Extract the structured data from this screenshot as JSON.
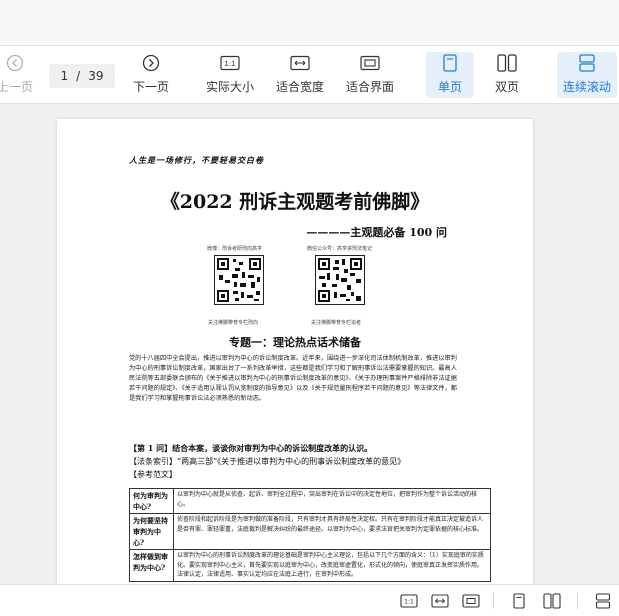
{
  "toolbar": {
    "prev_label": "上一页",
    "page_current": "1",
    "page_sep": "/",
    "page_total": "39",
    "next_label": "下一页",
    "actual_size_label": "实际大小",
    "fit_width_label": "适合宽度",
    "fit_page_label": "适合界面",
    "single_page_label": "单页",
    "double_page_label": "双页",
    "continuous_label": "连续滚动",
    "accent_color": "#1e7be0"
  },
  "document": {
    "motto": "人生是一场修行，不要轻易交白卷",
    "title": "《2022 刑诉主观题考前佛脚》",
    "subtitle": "————主观题必备 100 问",
    "qr_left_caption": "微博：刑诉考研刑向高亨",
    "qr_right_caption": "微信公众号：高亨讲刑法笔记",
    "qr_left_footer": "关注佛脚带育专栏刑向",
    "qr_right_footer": "关注佛脚带育专栏追者",
    "topic_heading": "专题一：理论热点话术储备",
    "intro": "党的十八届四中全会提出，推进以审判为中心的诉讼制度改革。近年来，围绕进一步深化司法体制机制改革，推进以审判为中心的刑事诉讼制度改革，国家出台了一系列改革举措，这些都是我们学习和了解刑事诉讼法需要掌握的知识。最高人民法院等五部委联合颁布的《关于推进以审判为中心的刑事诉讼制度改革的意见》、《关于办理刑事案件严格排除非法证据若干问题的规定》、《关于适用认罪认罚从宽制度的指导意见》以及《关于规范量刑程序若干问题的意见》等法律文件，都是我们学习和掌握刑事诉讼法必须熟悉的新动态。",
    "q1": "【第 1 问】结合本案，谈谈你对审判为中心的诉讼制度改革的认识。",
    "index": "【法条索引】“两高三部”《关于推进以审判为中心的刑事诉讼制度改革的意见》",
    "ref_label": "【参考范文】",
    "table": [
      {
        "q": "何为审判为中心?",
        "a": "以审判为中心就是从侦查、起诉、审判全过程中，突出审判在诉讼中的决定性地位，把审判作为整个诉讼活动的核心。"
      },
      {
        "q": "为何要坚持审判为中心?",
        "a": "侦查阶段和起诉阶段是为审判做的准备阶段，只有审判才具有终局性决定权。只有在审判阶段才能真正决定被追诉人是否有罪、罪轻罪重，法庭裁判是解决纠纷的最终途径。以审判为中心，要求法官把关审判为定罪依据的核心标准。"
      },
      {
        "q": "怎样做到审判为中心?",
        "a": "以审判为中心的刑事诉讼制度改革的理论基础是审判中心主义理论，包括以下几个方面的含义：（1）实现庭审的实质化。要实现审判中心主义，首先要实现以庭审为中心，改变庭审虚置化，形式化的倾向，使庭审真正发挥实质作用。法律认定，法律适用、事实认定均应在法庭上进行，在审判中形成。"
      }
    ]
  }
}
